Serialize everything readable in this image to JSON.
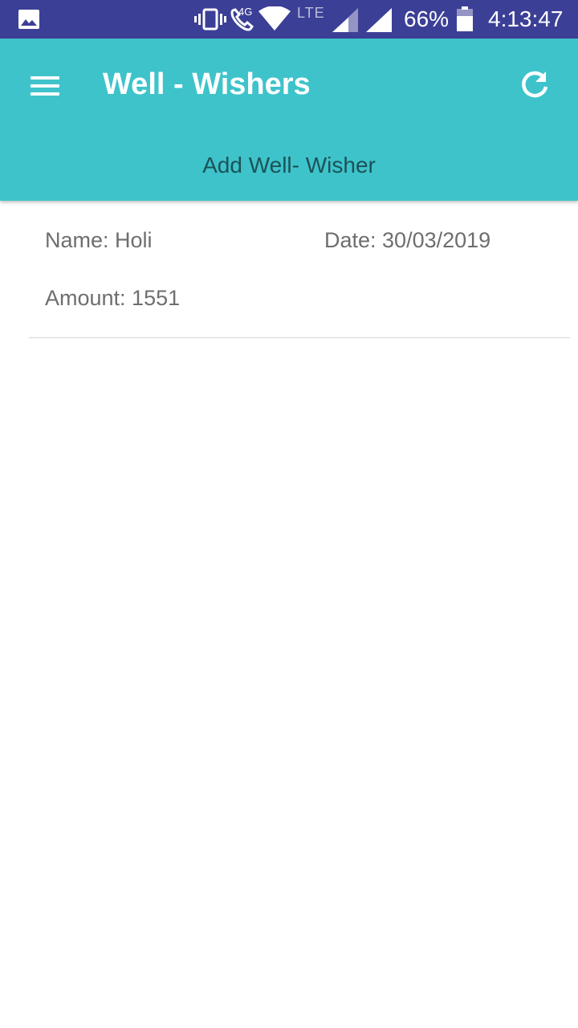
{
  "status_bar": {
    "network": "4G",
    "lte": "LTE",
    "battery": "66%",
    "time": "4:13:47",
    "icons": [
      "gallery-icon",
      "vibrate-icon",
      "call-icon",
      "wifi-icon",
      "signal-icon",
      "signal-icon",
      "battery-icon"
    ]
  },
  "toolbar": {
    "title": "Well - Wishers",
    "add_label": "Add Well- Wisher",
    "color": "#3ec3cb"
  },
  "entries": [
    {
      "name": "Name: Holi",
      "date": "Date: 30/03/2019",
      "amount": "Amount: 1551"
    }
  ]
}
